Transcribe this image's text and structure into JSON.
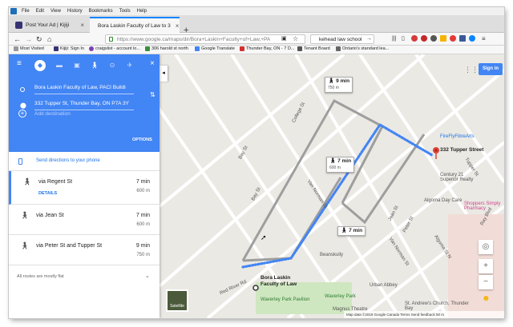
{
  "menu": {
    "items": [
      "File",
      "Edit",
      "View",
      "History",
      "Bookmarks",
      "Tools",
      "Help"
    ]
  },
  "tabs": [
    {
      "title": "Post Your Ad | Kijiji",
      "icon_color": "#373373"
    },
    {
      "title": "Bora Laskin Faculty of Law to 3",
      "icon_color": "#4285f4"
    }
  ],
  "nav": {
    "url": "https://www.google.ca/maps/dir/Bora+Laskin+Faculty+of+Law,+PA",
    "search": "kehead law school"
  },
  "bookmarks": [
    "Most Visited",
    "Kijiji: Sign In",
    "craigslist - account lo...",
    "306 harold st north",
    "Google Translate",
    "Thunder Bay, ON - 7 D...",
    "Tenant Board",
    "Ontario's standard lea..."
  ],
  "directions": {
    "origin": "Bora Laskin Faculty of Law, PACI Buildi",
    "destination": "332 Tupper St, Thunder Bay, ON P7A 3Y",
    "add_destination": "Add destination",
    "options": "OPTIONS",
    "send": "Send directions to your phone",
    "routes": [
      {
        "name": "via Regent St",
        "time": "7 min",
        "dist": "600 m",
        "details": "DETAILS"
      },
      {
        "name": "via Jean St",
        "time": "7 min",
        "dist": "600 m"
      },
      {
        "name": "via Peter St and Tupper St",
        "time": "9 min",
        "dist": "750 m"
      }
    ],
    "flat_note": "All routes are mostly flat"
  },
  "map": {
    "badges": [
      {
        "time": "9 min",
        "dist": "750 m"
      },
      {
        "time": "7 min",
        "dist": "600 m"
      },
      {
        "time": "7 min",
        "dist": ""
      }
    ],
    "destination_label": "332 Tupper Street",
    "origin_label_1": "Bora Laskin",
    "origin_label_2": "Faculty of Law",
    "pois": [
      "FireFlyFibreArts",
      "Century 21 Superior Realty",
      "Algoma Day Care",
      "Shoppers Simply Pharmacy",
      "Beanskully",
      "Urban Abbey",
      "Waverley Park",
      "Waverley Park Pavilion",
      "Magnus Theatre",
      "St. Andrew's Church, Thunder Bay"
    ],
    "streets": [
      "College St",
      "Van Norman St",
      "Bay St",
      "Algoma St N",
      "Red River Rd",
      "Van Norman St",
      "Tupper St",
      "Peter St",
      "Jean St",
      "Ray Blvd",
      "Bay St"
    ],
    "sign_in": "Sign in",
    "satellite": "Satellite",
    "footer": "Map data ©2019 Google   Canada   Terms   Send feedback   50 m"
  },
  "colors": {
    "route_blue": "#4285f4",
    "alt_route": "#9e9e9e",
    "header_blue": "#4285f4"
  }
}
